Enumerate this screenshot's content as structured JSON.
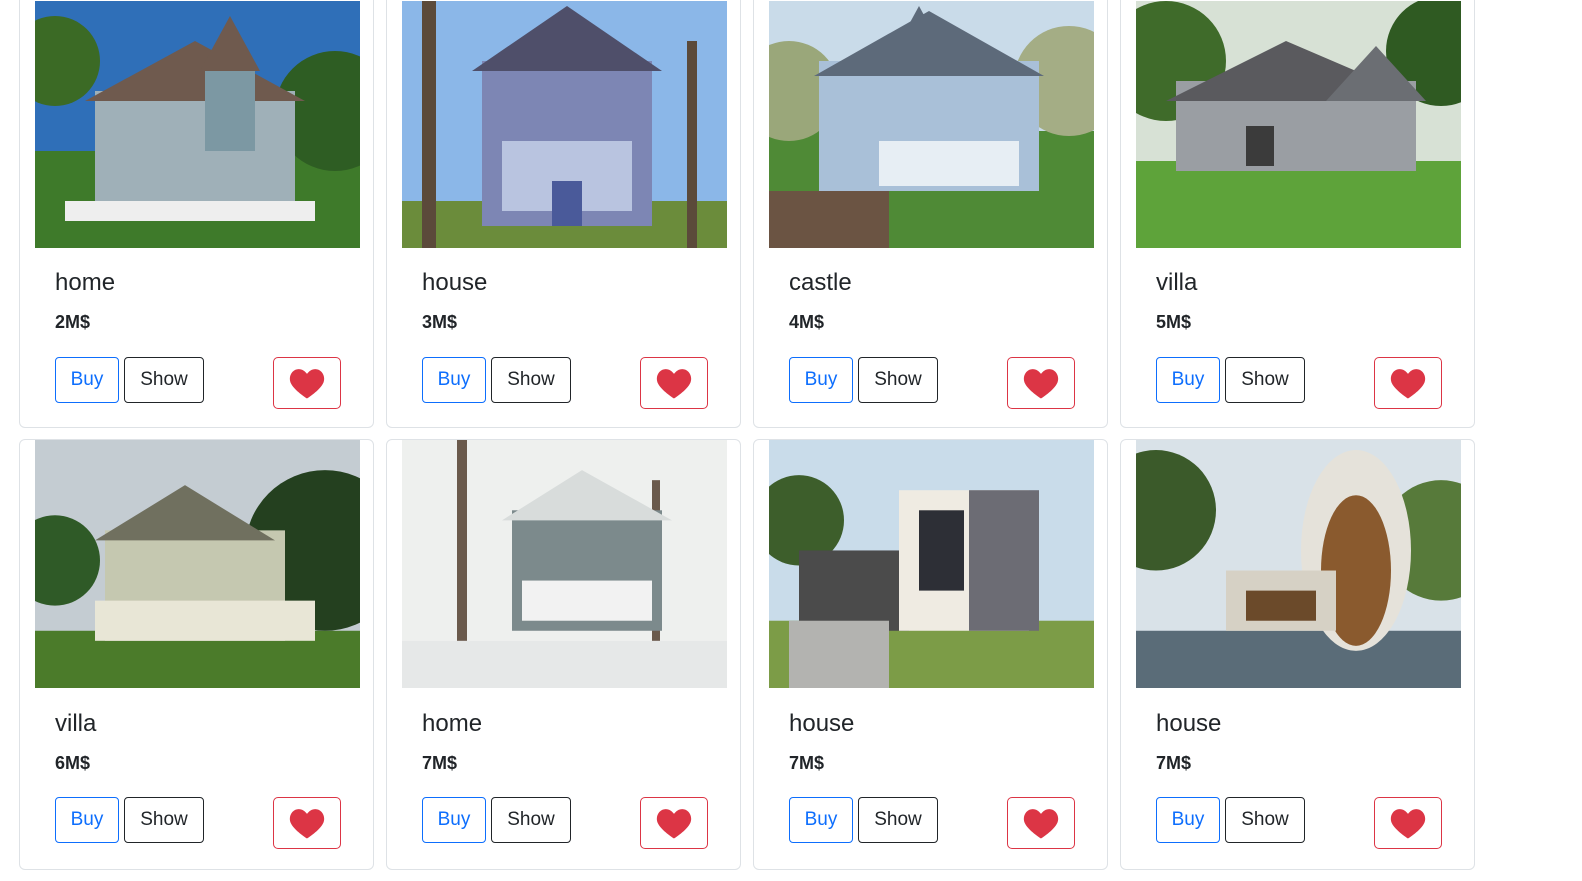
{
  "listings": [
    {
      "title": "home",
      "price": "2M$",
      "buy_label": "Buy",
      "show_label": "Show",
      "favorite_icon": "heart-icon"
    },
    {
      "title": "house",
      "price": "3M$",
      "buy_label": "Buy",
      "show_label": "Show",
      "favorite_icon": "heart-icon"
    },
    {
      "title": "castle",
      "price": "4M$",
      "buy_label": "Buy",
      "show_label": "Show",
      "favorite_icon": "heart-icon"
    },
    {
      "title": "villa",
      "price": "5M$",
      "buy_label": "Buy",
      "show_label": "Show",
      "favorite_icon": "heart-icon"
    },
    {
      "title": "villa",
      "price": "6M$",
      "buy_label": "Buy",
      "show_label": "Show",
      "favorite_icon": "heart-icon"
    },
    {
      "title": "home",
      "price": "7M$",
      "buy_label": "Buy",
      "show_label": "Show",
      "favorite_icon": "heart-icon"
    },
    {
      "title": "house",
      "price": "7M$",
      "buy_label": "Buy",
      "show_label": "Show",
      "favorite_icon": "heart-icon"
    },
    {
      "title": "house",
      "price": "7M$",
      "buy_label": "Buy",
      "show_label": "Show",
      "favorite_icon": "heart-icon"
    }
  ],
  "colors": {
    "primary": "#0d6efd",
    "danger": "#dc3545",
    "dark": "#212529",
    "border": "#dee2e6"
  }
}
